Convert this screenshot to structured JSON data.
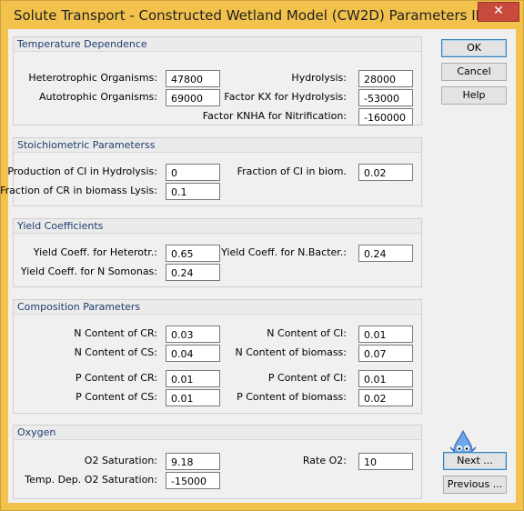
{
  "window": {
    "title": "Solute Transport - Constructed Wetland Model (CW2D) Parameters II",
    "close_symbol": "✕"
  },
  "buttons": {
    "ok": "OK",
    "cancel": "Cancel",
    "help": "Help",
    "next": "Next ...",
    "previous": "Previous ..."
  },
  "temperature": {
    "header": "Temperature Dependence",
    "heterotrophic_label": "Heterotrophic Organisms:",
    "heterotrophic_value": "47800",
    "autotrophic_label": "Autotrophic Organisms:",
    "autotrophic_value": "69000",
    "hydrolysis_label": "Hydrolysis:",
    "hydrolysis_value": "28000",
    "kx_label": "Factor KX for Hydrolysis:",
    "kx_value": "-53000",
    "knha_label": "Factor KNHA for Nitrification:",
    "knha_value": "-160000"
  },
  "stoich": {
    "header": "Stoichiometric Parameterss",
    "ci_hydrolysis_label": "Production of CI in Hydrolysis:",
    "ci_hydrolysis_value": "0",
    "cr_lysis_label": "Fraction of CR in biomass Lysis:",
    "cr_lysis_value": "0.1",
    "ci_biom_label": "Fraction of CI in biom.",
    "ci_biom_value": "0.02"
  },
  "yield": {
    "header": "Yield Coefficients",
    "heterotr_label": "Yield Coeff. for Heterotr.:",
    "heterotr_value": "0.65",
    "nsomonas_label": "Yield Coeff. for N Somonas:",
    "nsomonas_value": "0.24",
    "nbacter_label": "Yield Coeff. for N.Bacter.:",
    "nbacter_value": "0.24"
  },
  "composition": {
    "header": "Composition Parameters",
    "n_cr_label": "N Content of CR:",
    "n_cr_value": "0.03",
    "n_cs_label": "N Content of CS:",
    "n_cs_value": "0.04",
    "n_ci_label": "N Content of CI:",
    "n_ci_value": "0.01",
    "n_bio_label": "N Content of biomass:",
    "n_bio_value": "0.07",
    "p_cr_label": "P Content of CR:",
    "p_cr_value": "0.01",
    "p_cs_label": "P Content of CS:",
    "p_cs_value": "0.01",
    "p_ci_label": "P Content of CI:",
    "p_ci_value": "0.01",
    "p_bio_label": "P Content of biomass:",
    "p_bio_value": "0.02"
  },
  "oxygen": {
    "header": "Oxygen",
    "o2sat_label": "O2 Saturation:",
    "o2sat_value": "9.18",
    "tempdep_label": "Temp. Dep. O2 Saturation:",
    "tempdep_value": "-15000",
    "rate_label": "Rate O2:",
    "rate_value": "10"
  },
  "mascot_icon": "water-drop-mascot-icon"
}
